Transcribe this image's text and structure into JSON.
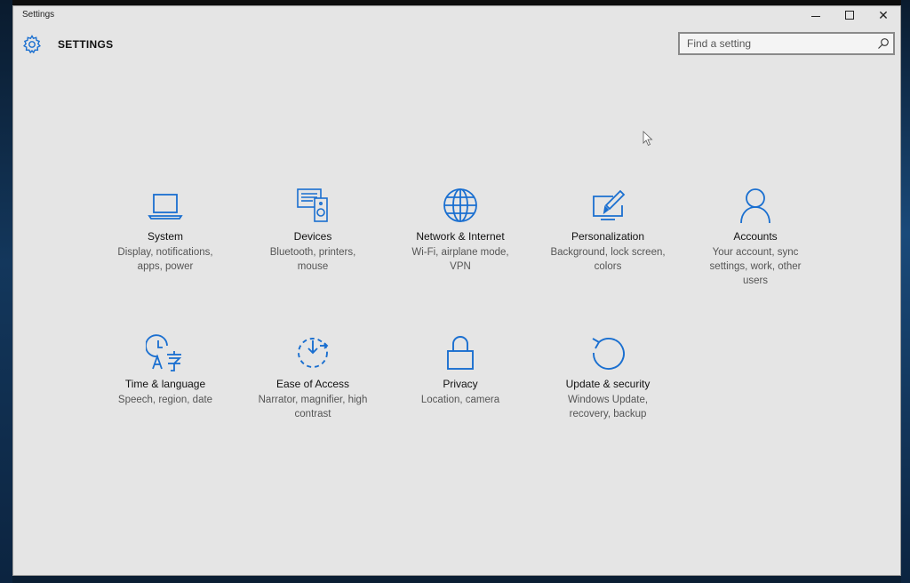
{
  "window": {
    "title": "Settings",
    "minimize_glyph": "",
    "close_glyph": "✕"
  },
  "header": {
    "title": "SETTINGS",
    "icon": "gear-icon"
  },
  "search": {
    "placeholder": "Find a setting",
    "icon": "search-icon"
  },
  "accent_color": "#1a6fd0",
  "tiles": [
    {
      "title": "System",
      "description": "Display, notifications, apps, power",
      "icon": "laptop-icon"
    },
    {
      "title": "Devices",
      "description": "Bluetooth, printers, mouse",
      "icon": "devices-icon"
    },
    {
      "title": "Network & Internet",
      "description": "Wi-Fi, airplane mode, VPN",
      "icon": "globe-icon"
    },
    {
      "title": "Personalization",
      "description": "Background, lock screen, colors",
      "icon": "personalization-icon"
    },
    {
      "title": "Accounts",
      "description": "Your account, sync settings, work, other users",
      "icon": "person-icon"
    },
    {
      "title": "Time & language",
      "description": "Speech, region, date",
      "icon": "time-language-icon"
    },
    {
      "title": "Ease of Access",
      "description": "Narrator, magnifier, high contrast",
      "icon": "ease-of-access-icon"
    },
    {
      "title": "Privacy",
      "description": "Location, camera",
      "icon": "lock-icon"
    },
    {
      "title": "Update & security",
      "description": "Windows Update, recovery, backup",
      "icon": "update-icon"
    }
  ]
}
